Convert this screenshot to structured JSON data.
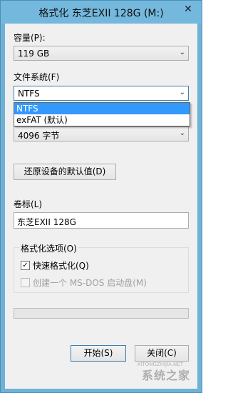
{
  "window": {
    "title": "格式化 东芝EXII 128G (M:)",
    "close_symbol": "✕"
  },
  "capacity": {
    "label": "容量(P):",
    "value": "119 GB"
  },
  "filesystem": {
    "label": "文件系统(F)",
    "value": "NTFS",
    "options": [
      "NTFS",
      "exFAT (默认)"
    ],
    "selected_index": 0
  },
  "allocation": {
    "value": "4096 字节"
  },
  "restore_button": "还原设备的默认值(D)",
  "volume": {
    "label": "卷标(L)",
    "value": "东芝EXII 128G"
  },
  "format_options": {
    "label": "格式化选项(O)",
    "quick_format": {
      "label": "快速格式化(Q)",
      "checked": true
    },
    "msdos": {
      "label": "创建一个 MS-DOS 启动盘(M)",
      "checked": false,
      "enabled": false
    }
  },
  "progress": {
    "value": 0
  },
  "buttons": {
    "start": "开始(S)",
    "close": "关闭(C)"
  },
  "watermark": {
    "text": "系统之家",
    "url": "XITONGZHIJIA.NET"
  }
}
